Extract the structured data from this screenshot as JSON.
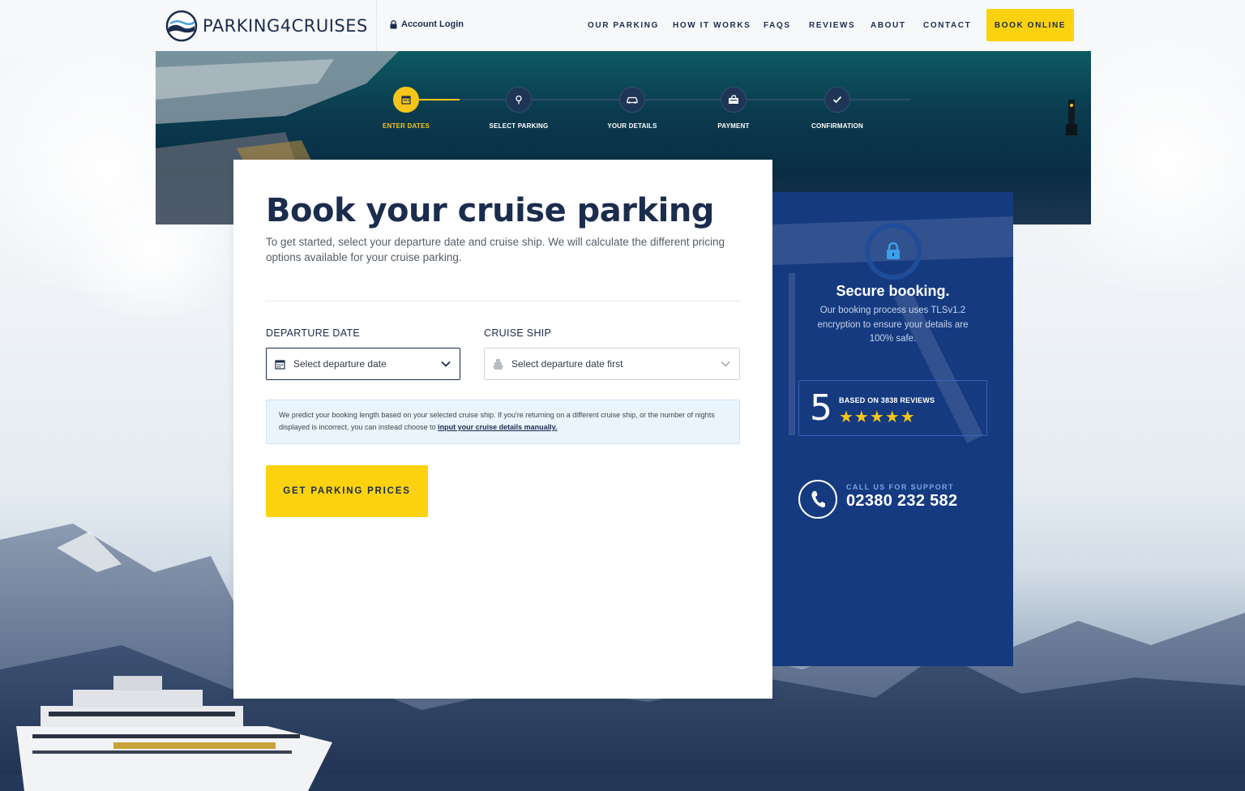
{
  "brand": {
    "name": "PARKING4CRUISES"
  },
  "header": {
    "account_login": "Account Login",
    "nav": [
      "OUR PARKING",
      "HOW IT WORKS",
      "FAQS",
      "REVIEWS",
      "ABOUT",
      "CONTACT"
    ],
    "book_online": "BOOK ONLINE"
  },
  "steps": [
    {
      "label": "ENTER DATES",
      "icon": "calendar-icon",
      "active": true
    },
    {
      "label": "SELECT PARKING",
      "icon": "map-pin-icon",
      "active": false
    },
    {
      "label": "YOUR DETAILS",
      "icon": "car-icon",
      "active": false
    },
    {
      "label": "PAYMENT",
      "icon": "payment-icon",
      "active": false
    },
    {
      "label": "CONFIRMATION",
      "icon": "check-icon",
      "active": false
    }
  ],
  "form": {
    "title": "Book your cruise parking",
    "intro": "To get started, select your departure date and cruise ship. We will calculate the different pricing options available for your cruise parking.",
    "departure_label": "DEPARTURE DATE",
    "departure_placeholder": "Select departure date",
    "ship_label": "CRUISE SHIP",
    "ship_placeholder": "Select departure date first",
    "notice_text": "We predict your booking length based on your selected cruise ship. If you're returning on a different cruise ship, or the number of nights displayed is incorrect, you can instead choose to ",
    "notice_link": "input your cruise details manually.",
    "cta": "GET PARKING PRICES"
  },
  "side": {
    "secure_title": "Secure booking.",
    "secure_text": "Our booking process uses TLSv1.2 encryption to ensure your details are 100% safe.",
    "rating": "5",
    "reviews_text": "BASED ON 3838 REVIEWS",
    "stars": "★★★★★",
    "call_label": "CALL US FOR SUPPORT",
    "call_number": "02380 232 582"
  },
  "colors": {
    "navy": "#1b2c4d",
    "yellow": "#fcd20f",
    "panel_blue": "#153a80"
  }
}
